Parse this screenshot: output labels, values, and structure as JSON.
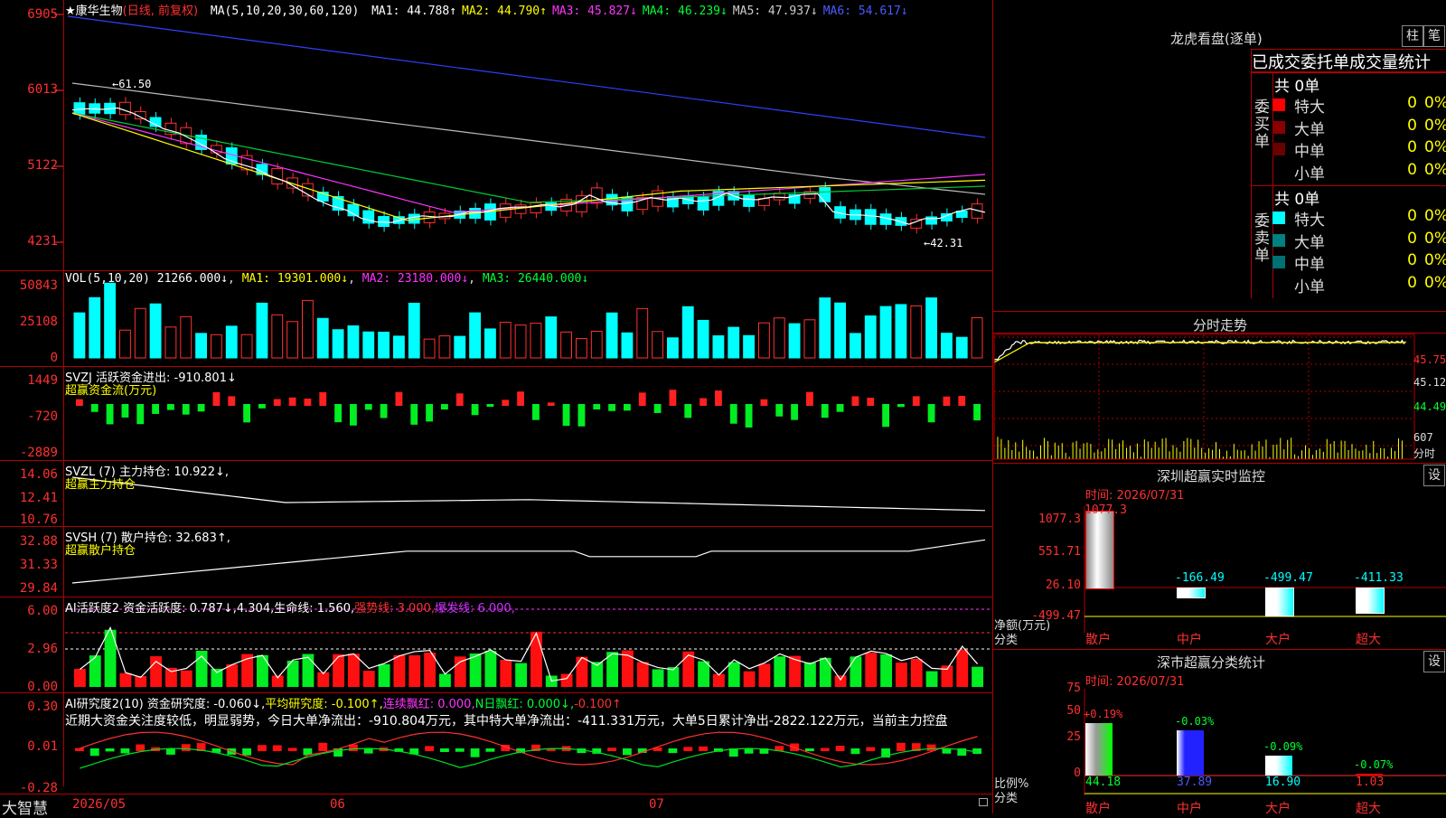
{
  "header": {
    "stock": "★康华生物",
    "period": "(日线, 前复权)",
    "ma_prefix": "MA(5,10,20,30,60,120)",
    "ma": [
      {
        "text": "MA1: 44.788↑",
        "color": "#ffffff"
      },
      {
        "text": "MA2: 44.790↑",
        "color": "#ffff00"
      },
      {
        "text": "MA3: 45.827↓",
        "color": "#ff33ff"
      },
      {
        "text": "MA4: 46.239↓",
        "color": "#00ff33"
      },
      {
        "text": "MA5: 47.937↓",
        "color": "#cccccc"
      },
      {
        "text": "MA6: 54.617↓",
        "color": "#4a5bff"
      }
    ]
  },
  "price_axis": [
    "6905",
    "6013",
    "5122",
    "4231"
  ],
  "price_annotations": {
    "high": "61.50",
    "low": "42.31"
  },
  "vol": {
    "header_prefix": "VOL(5,10,20)",
    "value": "21266.000↓",
    "ma1": "MA1: 19301.000↓",
    "ma2": "MA2: 23180.000↓",
    "ma3": "MA3: 26440.000↓",
    "axis": [
      "50843",
      "25108",
      "0"
    ]
  },
  "svzj": {
    "header": "SVZJ  活跃资金进出: -910.801↓",
    "sub": "超赢资金流(万元)",
    "axis": [
      "1449",
      "-720",
      "-2889"
    ]
  },
  "svzl": {
    "header": "SVZL (7) 主力持仓: 10.922↓,",
    "sub": "超赢主力持仓",
    "axis": [
      "14.06",
      "12.41",
      "10.76"
    ]
  },
  "svsh": {
    "header": "SVSH (7) 散户持仓: 32.683↑,",
    "sub": "超赢散户持仓",
    "axis": [
      "32.88",
      "31.33",
      "29.84"
    ]
  },
  "ai_active": {
    "header": "AI活跃度2 资金活跃度: 0.787↓,4.304,生命线: 1.560,",
    "strong": "强势线: 3.000,",
    "burst": "爆发线: 6.000,",
    "axis": [
      "6.00",
      "2.96",
      "0.00"
    ]
  },
  "ai_research": {
    "header_a": "AI研究度2(10) 资金研究度: -0.060↓,",
    "header_b": "平均研究度: -0.100↑,",
    "header_c": "连续飘红: 0.000,",
    "header_d": "N日飘红: 0.000↓,",
    "header_e": "-0.100↑",
    "commentary": "近期大资金关注度较低，明显弱势，今日大单净流出：-910.804万元，其中特大单净流出：-411.331万元，大单5日累计净出-2822.122万元，当前主力控盘",
    "axis": [
      "0.30",
      "0.01",
      "-0.28"
    ]
  },
  "timeline": {
    "logo": "大智慧",
    "labels": [
      "2026/05",
      "06",
      "07"
    ]
  },
  "dragon_tiger": {
    "title": "龙虎看盘(逐单)",
    "btn_bar": "柱",
    "btn_pen": "笔",
    "tab": "已成交委托单成交量统计",
    "buy": {
      "label": "委买单",
      "total": "共 0单",
      "rows": [
        {
          "label": "特大",
          "color": "#ff0000",
          "count": "0",
          "pct": "0%"
        },
        {
          "label": "大单",
          "color": "#8a0000",
          "count": "0",
          "pct": "0%"
        },
        {
          "label": "中单",
          "color": "#6a0000",
          "count": "0",
          "pct": "0%"
        },
        {
          "label": "小单",
          "color": "",
          "count": "0",
          "pct": "0%"
        }
      ]
    },
    "sell": {
      "label": "委卖单",
      "total": "共 0单",
      "rows": [
        {
          "label": "特大",
          "color": "#00ffff",
          "count": "0",
          "pct": "0%"
        },
        {
          "label": "大单",
          "color": "#008080",
          "count": "0",
          "pct": "0%"
        },
        {
          "label": "中单",
          "color": "#007070",
          "count": "0",
          "pct": "0%"
        },
        {
          "label": "小单",
          "color": "",
          "count": "0",
          "pct": "0%"
        }
      ]
    }
  },
  "intraday": {
    "title": "分时走势",
    "axis": [
      "45.75",
      "45.12",
      "44.49",
      "607",
      "分时"
    ]
  },
  "sz_monitor": {
    "title": "深圳超赢实时监控",
    "btn": "设",
    "time": "时间: 2026/07/31",
    "ylabels": [
      "1077.3",
      "551.71",
      "26.10",
      "-499.47"
    ],
    "ytitle": "净额(万元)",
    "xtitle": "分类",
    "bars": [
      {
        "cat": "散户",
        "value": "1077.3"
      },
      {
        "cat": "中户",
        "value": "-166.49"
      },
      {
        "cat": "大户",
        "value": "-499.47"
      },
      {
        "cat": "超大",
        "value": "-411.33"
      }
    ]
  },
  "sz_class": {
    "title": "深市超赢分类统计",
    "btn": "设",
    "time": "时间: 2026/07/31",
    "ylabels": [
      "75",
      "50",
      "25",
      "0"
    ],
    "ytitle": "比例%",
    "xtitle": "分类",
    "bars": [
      {
        "cat": "散户",
        "top": "+0.19%",
        "bottom": "44.18"
      },
      {
        "cat": "中户",
        "top": "-0.03%",
        "bottom": "37.89"
      },
      {
        "cat": "大户",
        "top": "-0.09%",
        "bottom": "16.90"
      },
      {
        "cat": "超大",
        "top": "-0.07%",
        "bottom": "1.03"
      }
    ]
  }
}
